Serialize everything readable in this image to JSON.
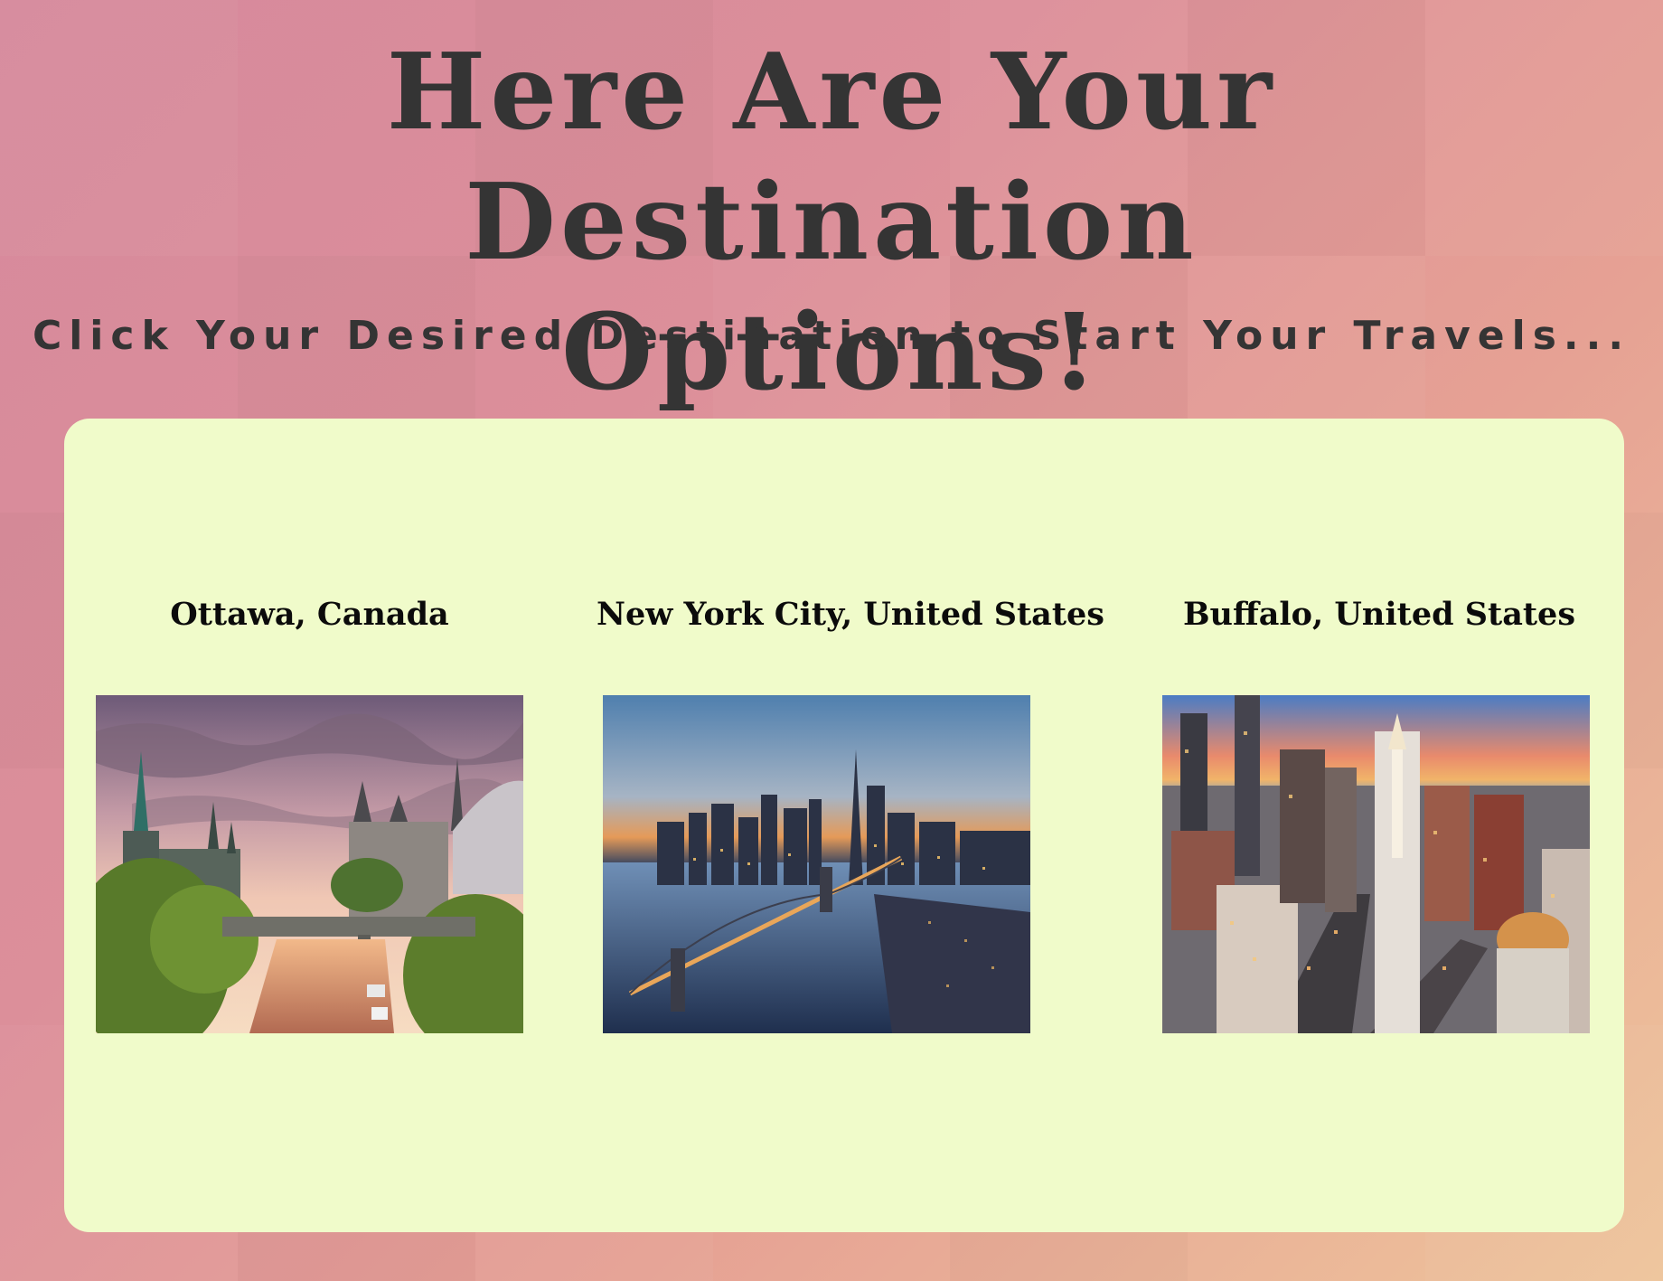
{
  "header": {
    "title_line1": "Here Are Your Destination",
    "title_line2": "Options!",
    "subtitle": "Click Your Desired Destination to Start Your Travels..."
  },
  "destinations": [
    {
      "label": "Ottawa, Canada",
      "photo": "ottawa-parliament-canal-sunset-photo"
    },
    {
      "label": "New York City, United States",
      "photo": "nyc-brooklyn-bridge-skyline-dusk-photo"
    },
    {
      "label": "Buffalo, United States",
      "photo": "buffalo-downtown-aerial-dusk-photo"
    }
  ],
  "colors": {
    "background_start": "#d6899c",
    "background_end": "#eec49b",
    "card": "#f0fbca",
    "heading_text": "#343434",
    "label_text": "#0b0b0b"
  }
}
